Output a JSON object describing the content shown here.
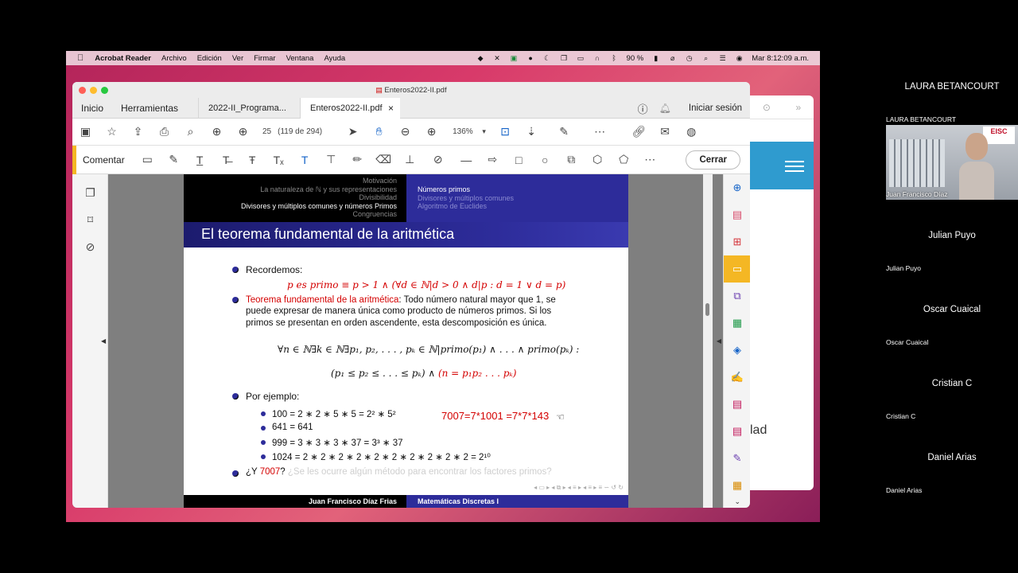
{
  "menubar": {
    "app": "Acrobat Reader",
    "menus": [
      "Archivo",
      "Edición",
      "Ver",
      "Firmar",
      "Ventana",
      "Ayuda"
    ],
    "battery": "90 %",
    "clock": "Mar  8:12:09 a.m."
  },
  "window": {
    "title": "Enteros2022-II.pdf",
    "nav_tabs": [
      "Inicio",
      "Herramientas"
    ],
    "doc_tabs": [
      "2022-II_Programa...",
      "Enteros2022-II.pdf"
    ],
    "tab_close": "×",
    "signin": "Iniciar sesión"
  },
  "toolbar": {
    "page_current": "25",
    "page_total": "(119 de 294)",
    "zoom": "136%"
  },
  "comment_bar": {
    "label": "Comentar",
    "close_label": "Cerrar"
  },
  "slide": {
    "header_left": [
      "Motivación",
      "La naturaleza de ℕ y sus representaciones",
      "Divisibilidad",
      "Divisores y múltiplos comunes y números Primos",
      "Congruencias"
    ],
    "header_right": [
      "Números primos",
      "Divisores y múltiplos comunes",
      "Algoritmo de Euclides"
    ],
    "title": "El teorema fundamental de la aritmética",
    "recordemos": "Recordemos:",
    "prime_def": "p es primo ≡ p > 1 ∧ (∀d ∈ ℕ|d > 0 ∧ d|p : d = 1 ∨ d = p)",
    "theorem_name": "Teorema fundamental de la aritmética",
    "theorem_line1": ": Todo número natural mayor que 1, se",
    "theorem_line2": "puede expresar de manera única como producto de números primos. Si los",
    "theorem_line3": "primos se presentan en orden ascendente, esta descomposición es única.",
    "formula1": "∀n ∈ ℕ∃k ∈ ℕ∃p₁, p₂, . . . , pₖ ∈ ℕ|primo(p₁) ∧ . . . ∧ primo(pₖ) :",
    "formula2a": "(p₁ ≤ p₂ ≤ . . . ≤ pₖ) ∧ ",
    "formula2b": "(n = p₁p₂ . . . pₖ)",
    "ejemplo": "Por ejemplo:",
    "examples": [
      "100 = 2 ∗ 2 ∗ 5 ∗ 5 = 2² ∗ 5²",
      "641 = 641",
      "999 = 3 ∗ 3 ∗ 3 ∗ 37 = 3³ ∗ 37",
      "1024 = 2 ∗ 2 ∗ 2 ∗ 2 ∗ 2 ∗ 2 ∗ 2 ∗ 2 ∗ 2 ∗ 2 = 2¹⁰"
    ],
    "handwritten": "7007=7*1001 =7*7*143",
    "question_pre": "¿Y ",
    "question_num": "7007",
    "question_post": "? ",
    "question_faded": "¿Se les ocurre algún método para encontrar los factores primos?",
    "footer_left": "Juan Francisco Díaz Frias",
    "footer_right": "Matemáticas Discretas I"
  },
  "background_window": {
    "partial_text": "lad"
  },
  "participants": {
    "speaker_top": "LAURA BETANCOURT",
    "speaker_label": "LAURA BETANCOURT",
    "active_name": "Juan Francisco Díaz",
    "logo_text": "EISC",
    "tiles": [
      {
        "name": "Julian Puyo",
        "label": "Julian Puyo"
      },
      {
        "name": "Oscar Cuaical",
        "label": "Oscar Cuaical"
      },
      {
        "name": "Cristian C",
        "label": "Cristian C"
      },
      {
        "name": "Daniel Arias",
        "label": "Daniel Arias"
      }
    ]
  },
  "colors": {
    "beamer_blue": "#2d2c9a",
    "accent_yellow": "#f4b724",
    "red_text": "#d40000"
  }
}
